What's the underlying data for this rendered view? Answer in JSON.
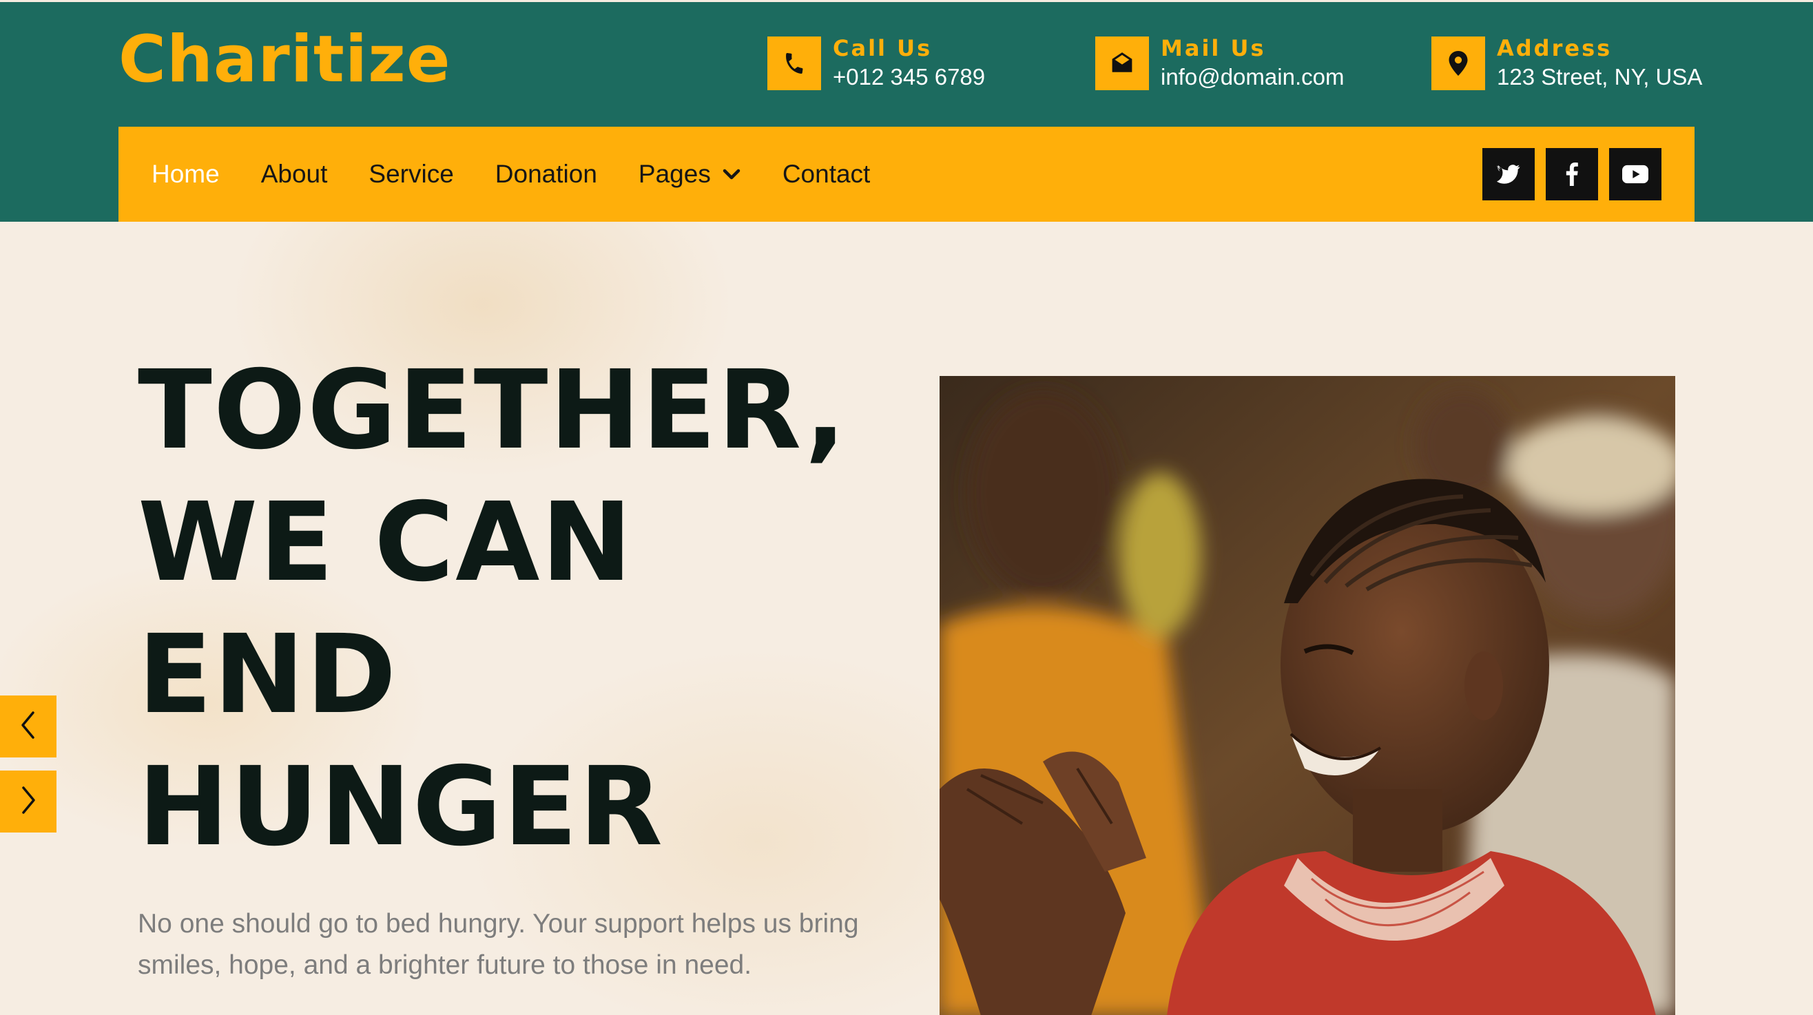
{
  "brand": {
    "logo_text": "Charitize"
  },
  "contacts": [
    {
      "label": "Call Us",
      "value": "+012 345 6789",
      "icon": "phone-icon"
    },
    {
      "label": "Mail Us",
      "value": "info@domain.com",
      "icon": "envelope-open-icon"
    },
    {
      "label": "Address",
      "value": "123 Street, NY, USA",
      "icon": "map-marker-icon"
    }
  ],
  "nav": {
    "items": [
      {
        "label": "Home",
        "active": true
      },
      {
        "label": "About"
      },
      {
        "label": "Service"
      },
      {
        "label": "Donation"
      },
      {
        "label": "Pages",
        "has_dropdown": true
      },
      {
        "label": "Contact"
      }
    ],
    "socials": [
      "twitter-icon",
      "facebook-icon",
      "youtube-icon"
    ]
  },
  "hero": {
    "headline_lines": [
      "TOGETHER,",
      "WE CAN",
      "END",
      "HUNGER"
    ],
    "subtext": "No one should go to bed hungry. Your support helps us bring smiles, hope, and a brighter future to those in need.",
    "carousel_controls": [
      "chevron-left-icon",
      "chevron-right-icon"
    ]
  },
  "colors": {
    "header_green": "#1c6b5f",
    "accent_yellow": "#ffaf0a",
    "heading_dark": "#0d1a16",
    "hero_bg": "#f6ede2"
  }
}
